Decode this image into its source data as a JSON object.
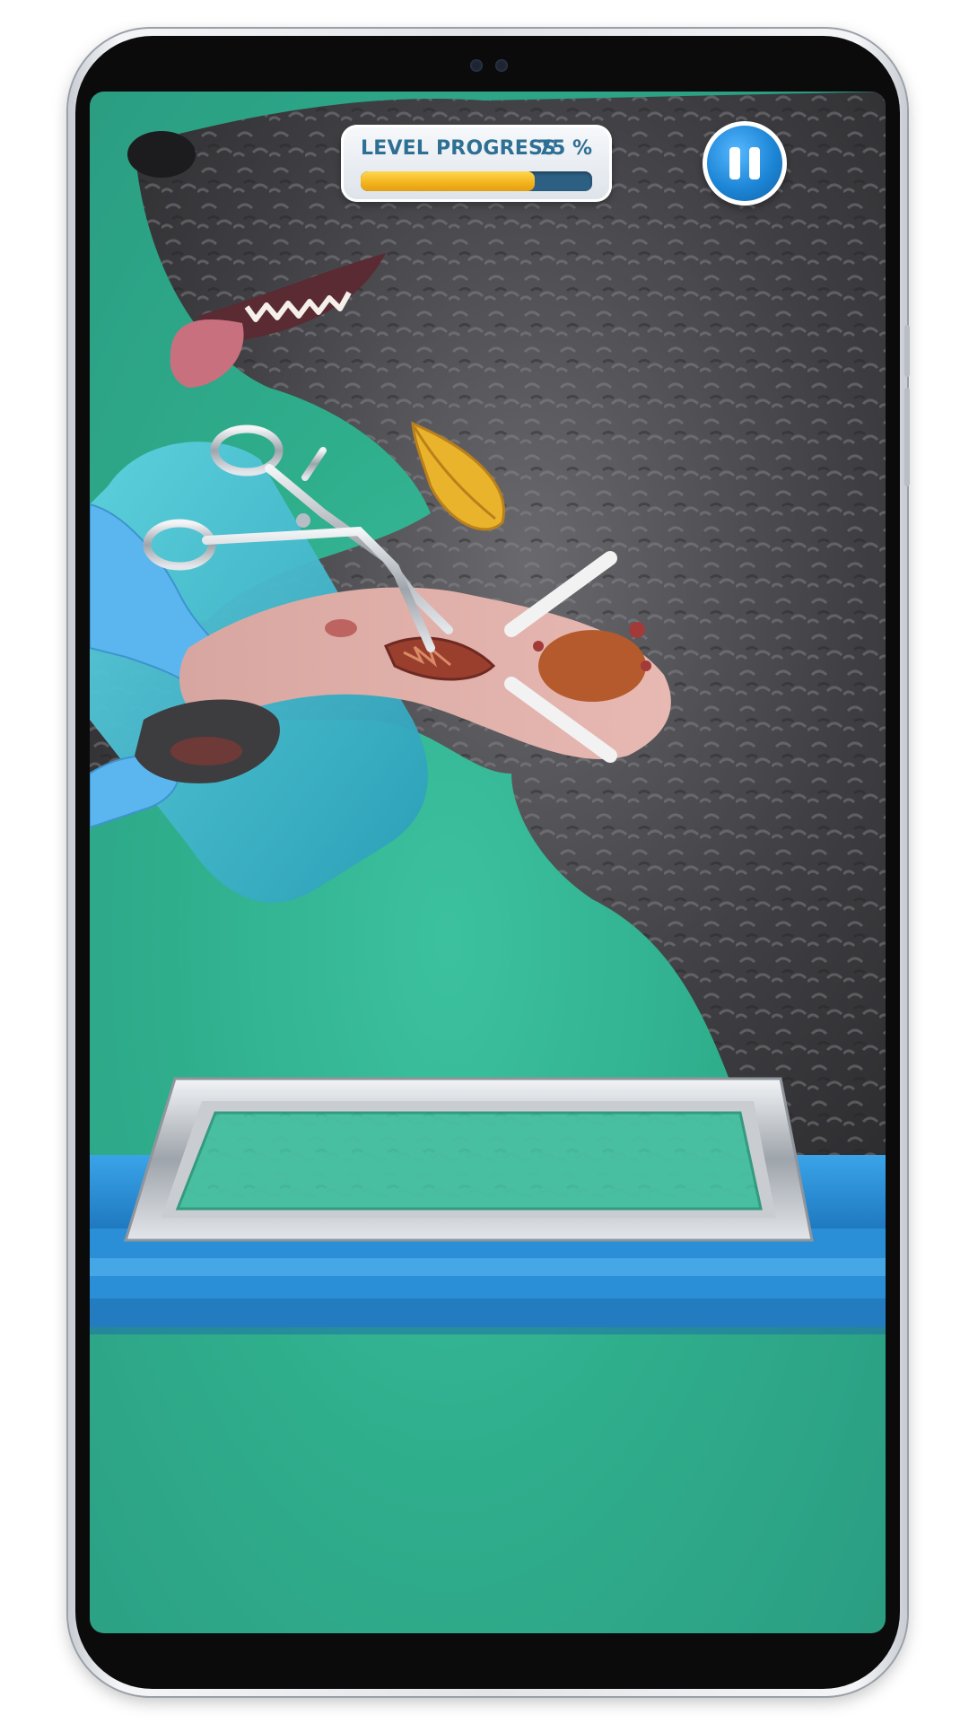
{
  "hud": {
    "progress_label": "LEVEL PROGRESS",
    "progress_value_text": "75 %",
    "progress_fraction": 0.75,
    "pause_icon": "pause-icon"
  },
  "colors": {
    "background_green": "#2fae8c",
    "progress_fill": "#f2b21d",
    "progress_track": "#2c5f82",
    "label_blue": "#2e6f94",
    "pause_blue": "#1d86d6",
    "tray_blue": "#2a8fd6"
  },
  "scene": {
    "patient": "dog",
    "tools": [
      "surgical-retractor-tool",
      "leaf-icon"
    ],
    "tray": "instrument-tray"
  }
}
